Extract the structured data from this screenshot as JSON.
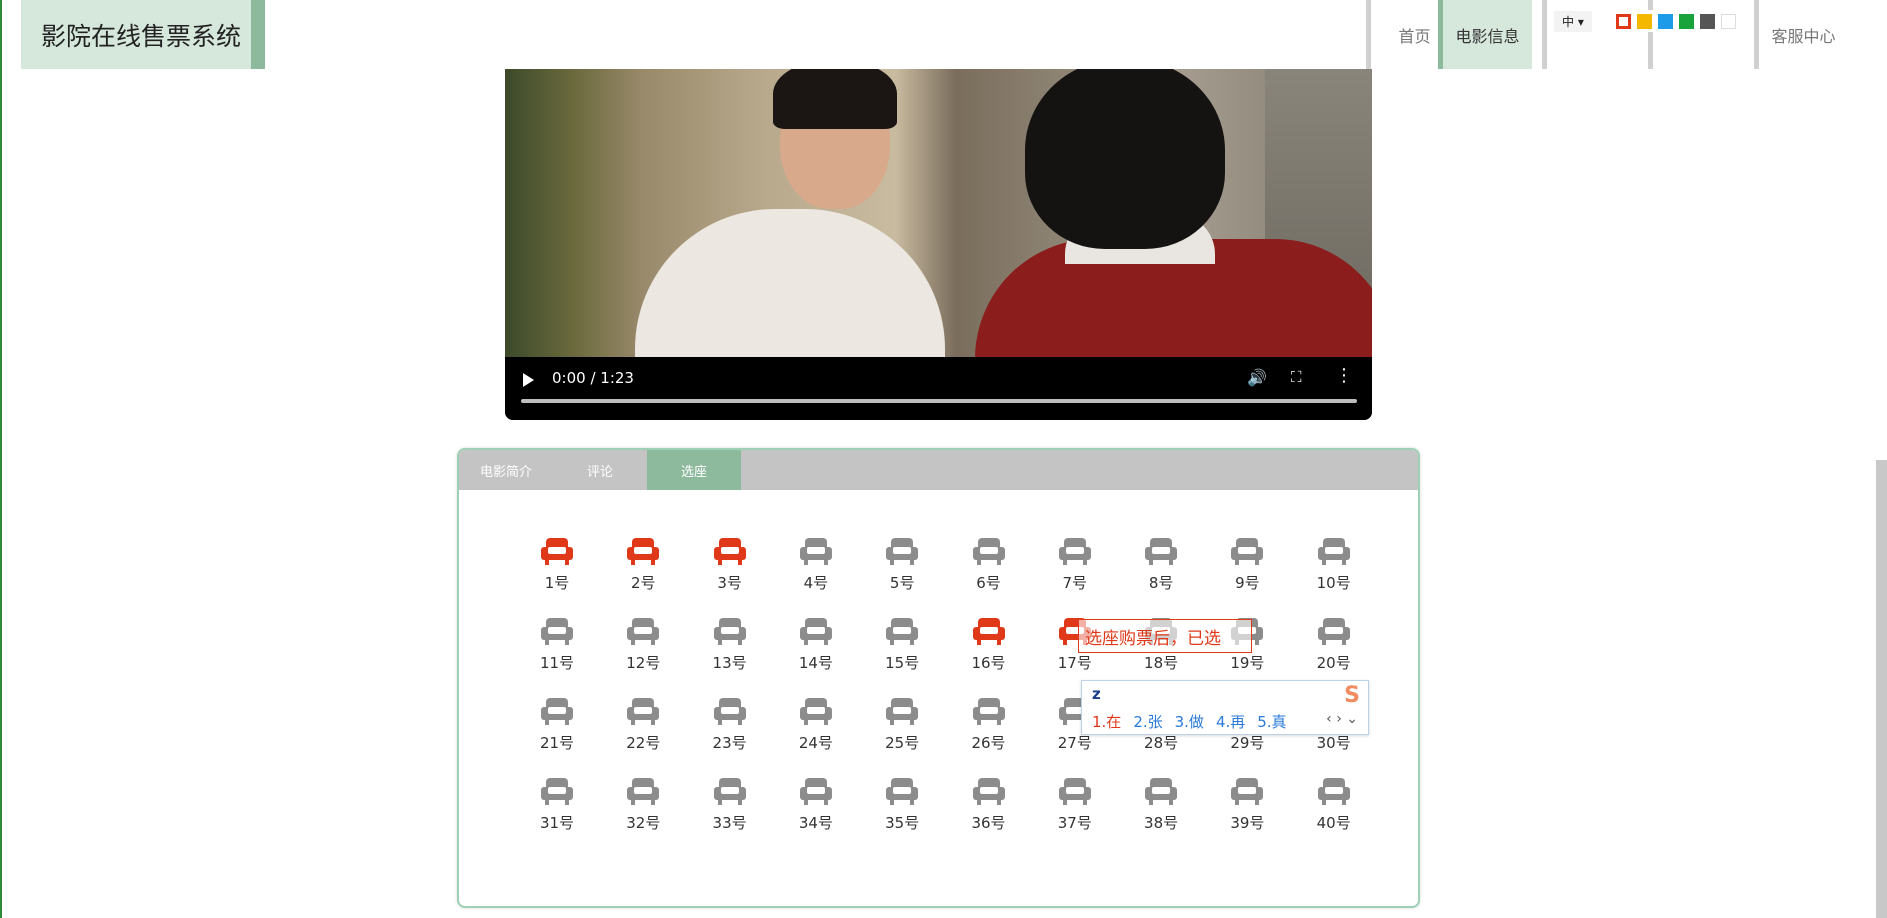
{
  "header": {
    "logo_text": "影院在线售票系统",
    "nav_items": [
      {
        "label": "首页"
      },
      {
        "label": "电影信息"
      },
      {
        "label": "客服中心"
      }
    ],
    "language_label": "中 ▾",
    "theme_colors": [
      "#e0391a",
      "#f5b800",
      "#1e9be8",
      "#1aa33a",
      "#555555",
      "#ffffff"
    ]
  },
  "video": {
    "time_display": "0:00 / 1:23",
    "progress": 0
  },
  "tabs": [
    {
      "label": "电影简介",
      "active": false
    },
    {
      "label": "评论",
      "active": false
    },
    {
      "label": "选座",
      "active": true
    }
  ],
  "seats": [
    {
      "label": "1号",
      "taken": true
    },
    {
      "label": "2号",
      "taken": true
    },
    {
      "label": "3号",
      "taken": true
    },
    {
      "label": "4号",
      "taken": false
    },
    {
      "label": "5号",
      "taken": false
    },
    {
      "label": "6号",
      "taken": false
    },
    {
      "label": "7号",
      "taken": false
    },
    {
      "label": "8号",
      "taken": false
    },
    {
      "label": "9号",
      "taken": false
    },
    {
      "label": "10号",
      "taken": false
    },
    {
      "label": "11号",
      "taken": false
    },
    {
      "label": "12号",
      "taken": false
    },
    {
      "label": "13号",
      "taken": false
    },
    {
      "label": "14号",
      "taken": false
    },
    {
      "label": "15号",
      "taken": false
    },
    {
      "label": "16号",
      "taken": true
    },
    {
      "label": "17号",
      "taken": true
    },
    {
      "label": "18号",
      "taken": false
    },
    {
      "label": "19号",
      "taken": false
    },
    {
      "label": "20号",
      "taken": false
    },
    {
      "label": "21号",
      "taken": false
    },
    {
      "label": "22号",
      "taken": false
    },
    {
      "label": "23号",
      "taken": false
    },
    {
      "label": "24号",
      "taken": false
    },
    {
      "label": "25号",
      "taken": false
    },
    {
      "label": "26号",
      "taken": false
    },
    {
      "label": "27号",
      "taken": false
    },
    {
      "label": "28号",
      "taken": false
    },
    {
      "label": "29号",
      "taken": false
    },
    {
      "label": "30号",
      "taken": false
    },
    {
      "label": "31号",
      "taken": false
    },
    {
      "label": "32号",
      "taken": false
    },
    {
      "label": "33号",
      "taken": false
    },
    {
      "label": "34号",
      "taken": false
    },
    {
      "label": "35号",
      "taken": false
    },
    {
      "label": "36号",
      "taken": false
    },
    {
      "label": "37号",
      "taken": false
    },
    {
      "label": "38号",
      "taken": false
    },
    {
      "label": "39号",
      "taken": false
    },
    {
      "label": "40号",
      "taken": false
    }
  ],
  "tooltip_text": "选座购票后，已选",
  "ime": {
    "input": "z",
    "candidates": [
      "1.在",
      "2.张",
      "3.做",
      "4.再",
      "5.真"
    ],
    "nav": "‹ › ⌄",
    "logo": "S"
  }
}
